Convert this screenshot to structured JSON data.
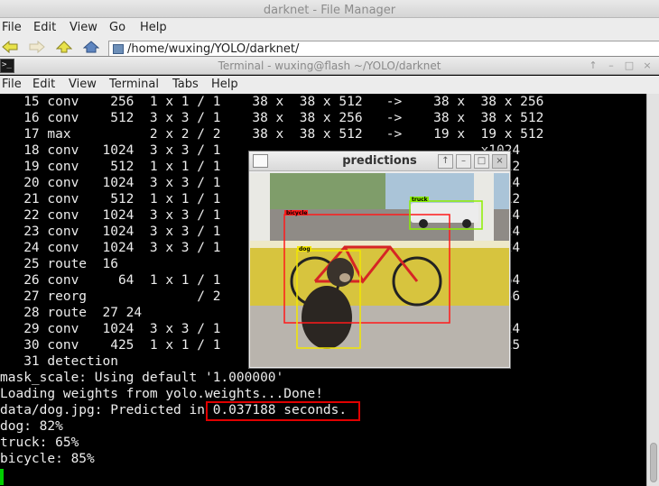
{
  "file_manager": {
    "title": "darknet - File Manager",
    "menu": [
      "File",
      "Edit",
      "View",
      "Go",
      "Help"
    ],
    "path": "/home/wuxing/YOLO/darknet/"
  },
  "terminal": {
    "icon_glyph": ">_",
    "title": "Terminal - wuxing@flash ~/YOLO/darknet",
    "window_buttons": [
      "↑",
      "–",
      "□",
      "×"
    ],
    "menu": [
      "File",
      "Edit",
      "View",
      "Terminal",
      "Tabs",
      "Help"
    ],
    "lines": [
      "   15 conv    256  1 x 1 / 1    38 x  38 x 512   ->    38 x  38 x 256",
      "   16 conv    512  3 x 3 / 1    38 x  38 x 256   ->    38 x  38 x 512",
      "   17 max          2 x 2 / 2    38 x  38 x 512   ->    19 x  19 x 512",
      "   18 conv   1024  3 x 3 / 1                                 x1024",
      "   19 conv    512  1 x 1 / 1                                 x 512",
      "   20 conv   1024  3 x 3 / 1                                 x1024",
      "   21 conv    512  1 x 1 / 1                                 x 512",
      "   22 conv   1024  3 x 3 / 1                                 x1024",
      "   23 conv   1024  3 x 3 / 1                                 x1024",
      "   24 conv   1024  3 x 3 / 1                                 x1024",
      "   25 route  16",
      "   26 conv     64  1 x 1 / 1                                 x  64",
      "   27 reorg              / 2                                 x 256",
      "   28 route  27 24",
      "   29 conv   1024  3 x 3 / 1                                 x1024",
      "   30 conv    425  1 x 1 / 1                                 x 425",
      "   31 detection",
      "mask_scale: Using default '1.000000'",
      "Loading weights from yolo.weights...Done!",
      "data/dog.jpg: Predicted in 0.037188 seconds.",
      "dog: 82%",
      "truck: 65%",
      "bicycle: 85%"
    ]
  },
  "predictions_window": {
    "title": "predictions",
    "window_buttons": [
      "↑",
      "–",
      "□",
      "×"
    ],
    "detections": [
      {
        "label": "bicycle",
        "color": "#ff1a1a"
      },
      {
        "label": "dog",
        "color": "#f2e600"
      },
      {
        "label": "truck",
        "color": "#8cf000"
      }
    ]
  }
}
